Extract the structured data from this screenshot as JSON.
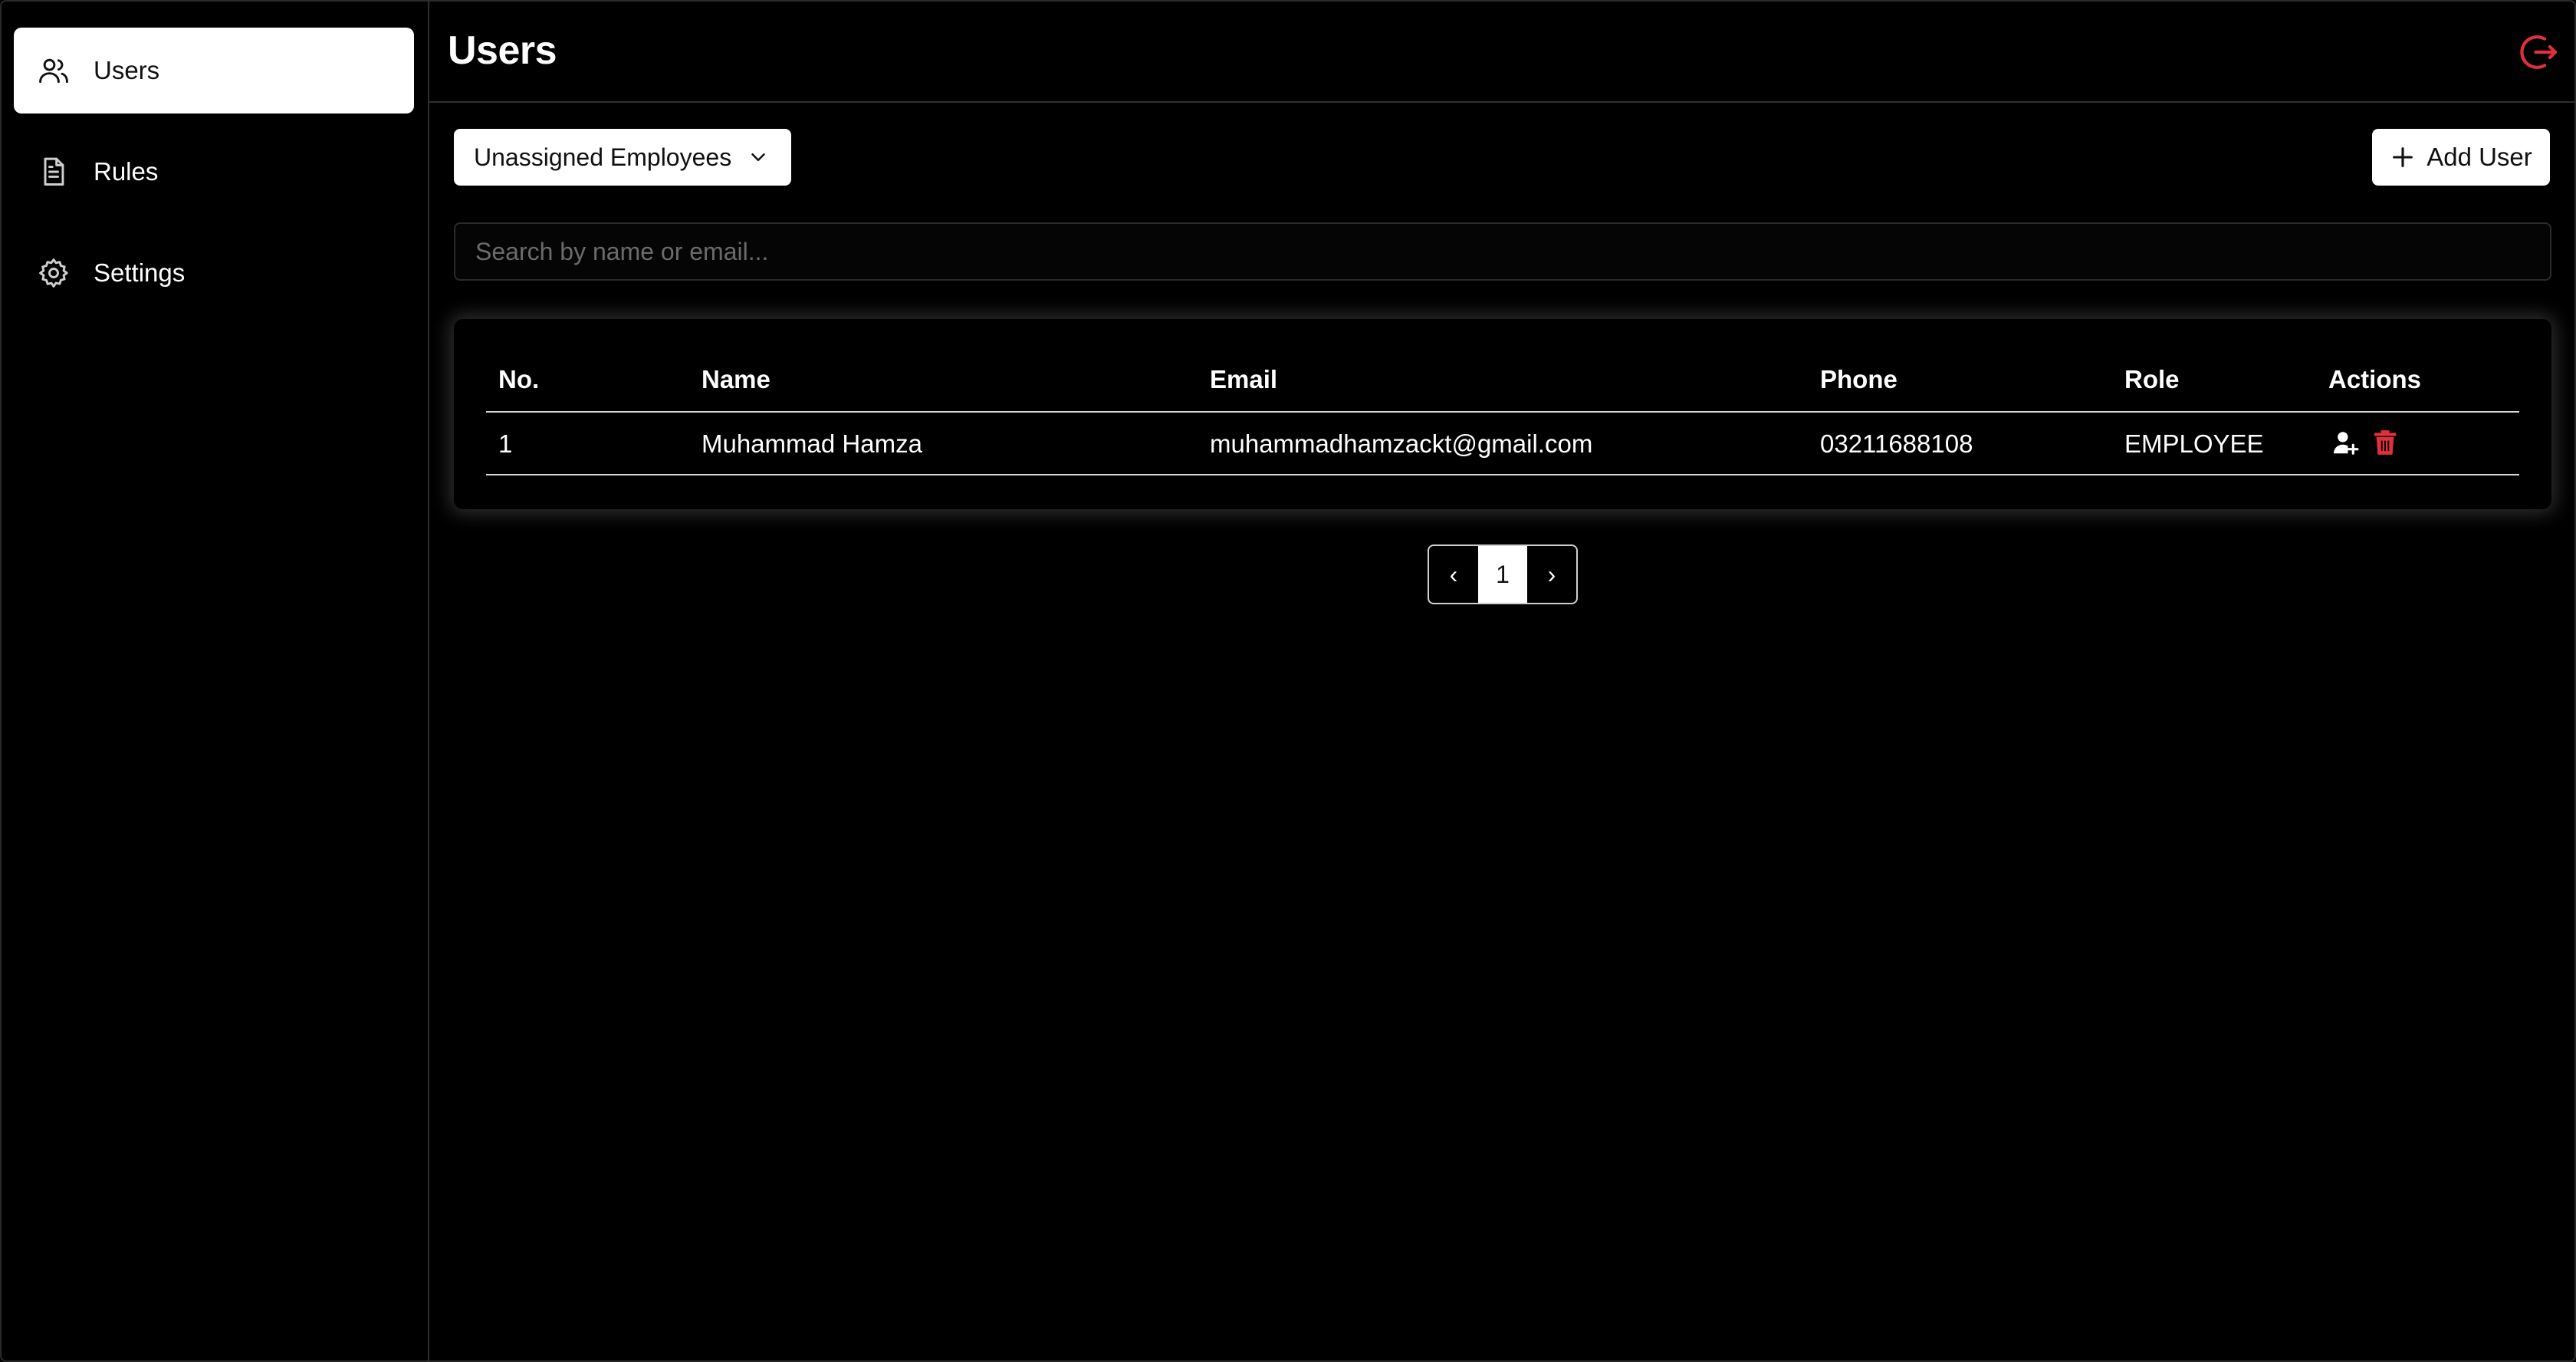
{
  "sidebar": {
    "items": [
      {
        "label": "Users",
        "icon": "users-icon",
        "active": true
      },
      {
        "label": "Rules",
        "icon": "document-icon",
        "active": false
      },
      {
        "label": "Settings",
        "icon": "gear-icon",
        "active": false
      }
    ]
  },
  "header": {
    "title": "Users",
    "logout_icon": "logout-icon"
  },
  "toolbar": {
    "filter_value": "Unassigned Employees",
    "add_user_label": "Add User"
  },
  "search": {
    "placeholder": "Search by name or email...",
    "value": ""
  },
  "table": {
    "columns": [
      "No.",
      "Name",
      "Email",
      "Phone",
      "Role",
      "Actions"
    ],
    "rows": [
      {
        "no": "1",
        "name": "Muhammad Hamza",
        "email": "muhammadhamzackt@gmail.com",
        "phone": "03211688108",
        "role": "EMPLOYEE",
        "actions": [
          "assign-user-icon",
          "trash-icon"
        ]
      }
    ]
  },
  "pagination": {
    "prev": "‹",
    "current": "1",
    "next": "›"
  },
  "colors": {
    "background": "#000000",
    "danger": "#e0303a",
    "surface": "#ffffff"
  }
}
